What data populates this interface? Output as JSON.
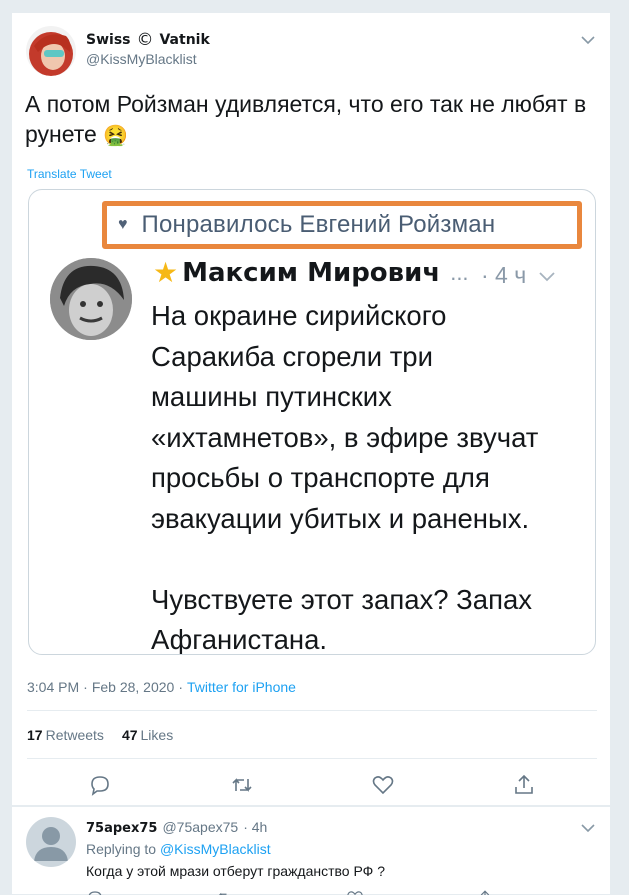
{
  "tweet": {
    "display_name": "Swiss",
    "display_name_suffix": "Vatnik",
    "copyright_symbol": "©",
    "handle": "@KissMyBlacklist",
    "text": "А потом Ройзман удивляется, что его так не любят в рунете",
    "emoji": "🤮",
    "translate_label": "Translate Tweet",
    "time": "3:04 PM",
    "date": "Feb 28, 2020",
    "source": "Twitter for iPhone",
    "retweets_count": "17",
    "retweets_label": "Retweets",
    "likes_count": "47",
    "likes_label": "Likes"
  },
  "screenshot": {
    "liked_label": "Понравилось Евгений Ройзман",
    "author_name": "Максим Мирович",
    "ellipsis": "...",
    "time": "· 4 ч",
    "text": "На окраине сирийского\nСаракиба сгорели три\nмашины путинских\n«ихтамнетов», в эфире звучат\nпросьбы о транспорте для\nэвакуации убитых и раненых.\n\nЧувствуете этот запах? Запах\nАфганистана."
  },
  "reply": {
    "display_name": "75apex75",
    "handle": "@75apex75",
    "time": "· 4h",
    "replying_prefix": "Replying to",
    "replying_to": "@KissMyBlacklist",
    "text": "Когда у этой мрази отберут гражданство РФ ?"
  },
  "icons": {
    "reply": "reply-icon",
    "retweet": "retweet-icon",
    "like": "heart-icon",
    "share": "share-icon",
    "caret": "chevron-down-icon"
  },
  "colors": {
    "accent": "#1da1f2",
    "highlight_border": "#e9873d",
    "muted": "#657786"
  }
}
